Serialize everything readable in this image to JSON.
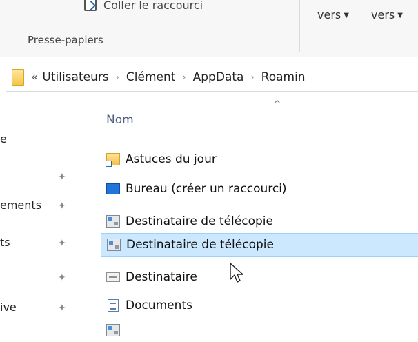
{
  "ribbon": {
    "paste_shortcut_label": "Coller le raccourci",
    "group_label": "Presse-papiers",
    "move_to_label": "vers",
    "copy_to_label": "vers"
  },
  "address": {
    "overflow": "«",
    "crumbs": [
      "Utilisateurs",
      "Clément",
      "AppData",
      "Roamin"
    ]
  },
  "nav": {
    "items": [
      "e",
      "ements",
      "ts",
      "",
      "ive"
    ]
  },
  "list": {
    "column_name": "Nom",
    "items": [
      {
        "label": "Astuces du jour",
        "icon": "folder-shortcut-icon"
      },
      {
        "label": "Bureau (créer un raccourci)",
        "icon": "desktop-icon"
      },
      {
        "label": "Destinataire de télécopie",
        "icon": "fax-icon"
      },
      {
        "label": "Destinataire de télécopie",
        "icon": "fax-icon"
      },
      {
        "label": "Destinataire",
        "icon": "mail-recipient-icon"
      },
      {
        "label": "Documents",
        "icon": "document-icon"
      }
    ]
  },
  "colors": {
    "selected_row": "#cce8ff",
    "selected_border": "#99d1ff",
    "header_text": "#4d6082"
  }
}
